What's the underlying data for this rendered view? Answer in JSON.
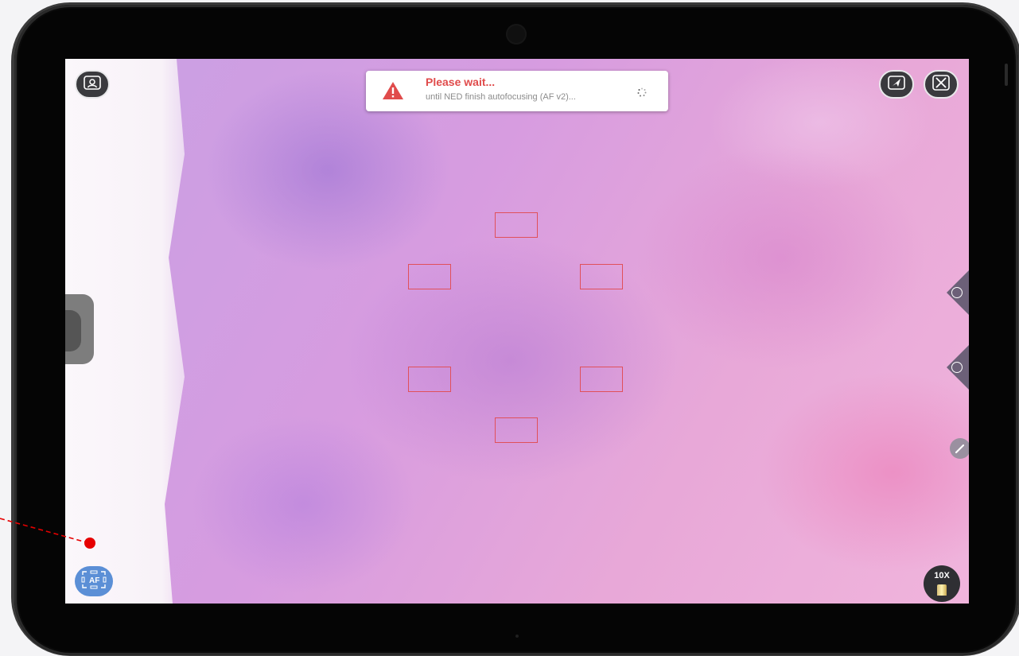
{
  "toast": {
    "title": "Please wait...",
    "message": "until NED finish autofocusing (AF v2)..."
  },
  "magnification": {
    "label": "10X"
  },
  "autofocus_button": {
    "label": "AF"
  },
  "colors": {
    "toast_title": "#e04b4b",
    "af_region_border": "#e0505a",
    "af_button": "#5b8fd6",
    "annotation": "#e60000"
  },
  "icons": {
    "top_left": "user-frame-icon",
    "top_right_1": "send-icon",
    "top_right_2": "close-frame-icon",
    "side_tab_1": "move-icon",
    "side_tab_2": "info-icon",
    "side_btn": "pencil-icon",
    "bottom_left": "autofocus-icon",
    "bottom_right": "objective-lens-icon"
  }
}
